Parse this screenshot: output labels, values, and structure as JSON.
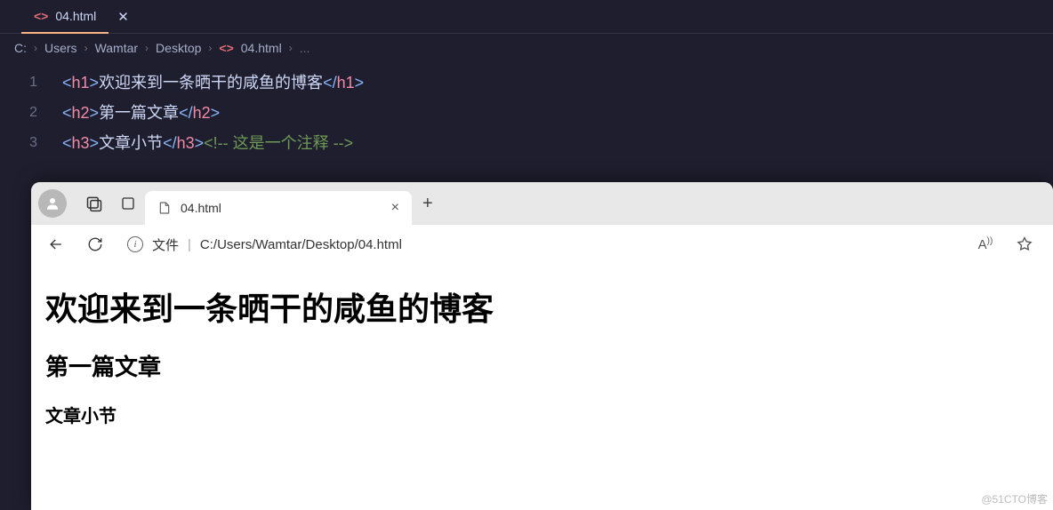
{
  "editor": {
    "tab": {
      "filename": "04.html"
    },
    "breadcrumbs": {
      "c": "C:",
      "users": "Users",
      "wamtar": "Wamtar",
      "desktop": "Desktop",
      "file": "04.html",
      "end": "..."
    },
    "lines": {
      "l1": {
        "n": "1",
        "tag": "h1",
        "text": "欢迎来到一条晒干的咸鱼的博客"
      },
      "l2": {
        "n": "2",
        "tag": "h2",
        "text": "第一篇文章"
      },
      "l3": {
        "n": "3",
        "tag": "h3",
        "text": "文章小节",
        "comment": "<!-- 这是一个注释 -->"
      }
    }
  },
  "browser": {
    "tab_title": "04.html",
    "addr_label": "文件",
    "addr_path": "C:/Users/Wamtar/Desktop/04.html"
  },
  "page": {
    "h1": "欢迎来到一条晒干的咸鱼的博客",
    "h2": "第一篇文章",
    "h3": "文章小节"
  },
  "watermark": "@51CTO博客"
}
